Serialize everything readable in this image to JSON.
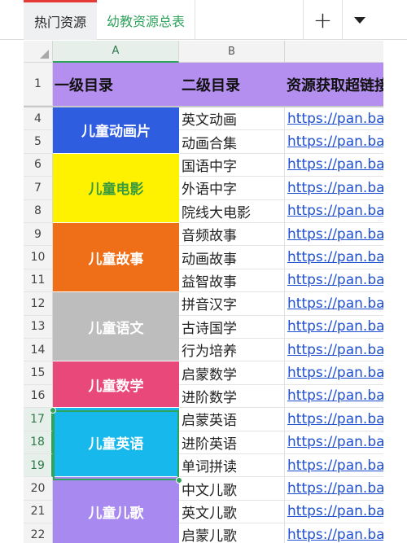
{
  "tabs": [
    {
      "label": "热门资源",
      "active": true
    },
    {
      "label": "幼教资源总表",
      "active": false
    }
  ],
  "toolbar": {
    "add_label": "+"
  },
  "columns": [
    "A",
    "B"
  ],
  "header_row": {
    "row_number": "1",
    "col_a": "一级目录",
    "col_b": "二级目录",
    "col_c": "资源获取超链接"
  },
  "categories": [
    {
      "label": "儿童动画片",
      "bg": "#2f5de0",
      "fg": "#ffffff"
    },
    {
      "label": "儿童电影",
      "bg": "#fff200",
      "fg": "#3a9a3e"
    },
    {
      "label": "儿童故事",
      "bg": "#ee6f17",
      "fg": "#ffffff"
    },
    {
      "label": "儿童语文",
      "bg": "#bdbdbd",
      "fg": "#ffffff"
    },
    {
      "label": "儿童数学",
      "bg": "#e8497a",
      "fg": "#ffffff"
    },
    {
      "label": "儿童英语",
      "bg": "#17b8ec",
      "fg": "#ffffff"
    },
    {
      "label": "儿童儿歌",
      "bg": "#a889f0",
      "fg": "#ffffff"
    }
  ],
  "rows": [
    {
      "num": "4",
      "sub": "英文动画",
      "link": "https://pan.baidu.com"
    },
    {
      "num": "5",
      "sub": "动画合集",
      "link": "https://pan.baidu.com"
    },
    {
      "num": "6",
      "sub": "国语中字",
      "link": "https://pan.baidu.com"
    },
    {
      "num": "7",
      "sub": "外语中字",
      "link": "https://pan.baidu.com"
    },
    {
      "num": "8",
      "sub": "院线大电影",
      "link": "https://pan.baidu.com"
    },
    {
      "num": "9",
      "sub": "音频故事",
      "link": "https://pan.baidu.com"
    },
    {
      "num": "10",
      "sub": "动画故事",
      "link": "https://pan.baidu.com"
    },
    {
      "num": "11",
      "sub": "益智故事",
      "link": "https://pan.baidu.com"
    },
    {
      "num": "12",
      "sub": "拼音汉字",
      "link": "https://pan.baidu.com"
    },
    {
      "num": "13",
      "sub": "古诗国学",
      "link": "https://pan.baidu.com"
    },
    {
      "num": "14",
      "sub": "行为培养",
      "link": "https://pan.baidu.com"
    },
    {
      "num": "15",
      "sub": "启蒙数学",
      "link": "https://pan.baidu.com"
    },
    {
      "num": "16",
      "sub": "进阶数学",
      "link": "https://pan.baidu.com"
    },
    {
      "num": "17",
      "sub": "启蒙英语",
      "link": "https://pan.baidu.com"
    },
    {
      "num": "18",
      "sub": "进阶英语",
      "link": "https://pan.baidu.com"
    },
    {
      "num": "19",
      "sub": "单词拼读",
      "link": "https://pan.baidu.com"
    },
    {
      "num": "20",
      "sub": "中文儿歌",
      "link": "https://pan.baidu.com"
    },
    {
      "num": "21",
      "sub": "英文儿歌",
      "link": "https://pan.baidu.com"
    },
    {
      "num": "22",
      "sub": "启蒙儿歌",
      "link": "https://pan.baidu.com"
    }
  ],
  "colors": {
    "accent": "#2fa25c",
    "active_tab_marker": "#e53935",
    "header_bg": "#b48ff0",
    "link": "#1f4fd1"
  },
  "icons": {
    "add": "plus-icon",
    "more": "caret-down-icon",
    "select_all": "select-all-corner-icon"
  }
}
